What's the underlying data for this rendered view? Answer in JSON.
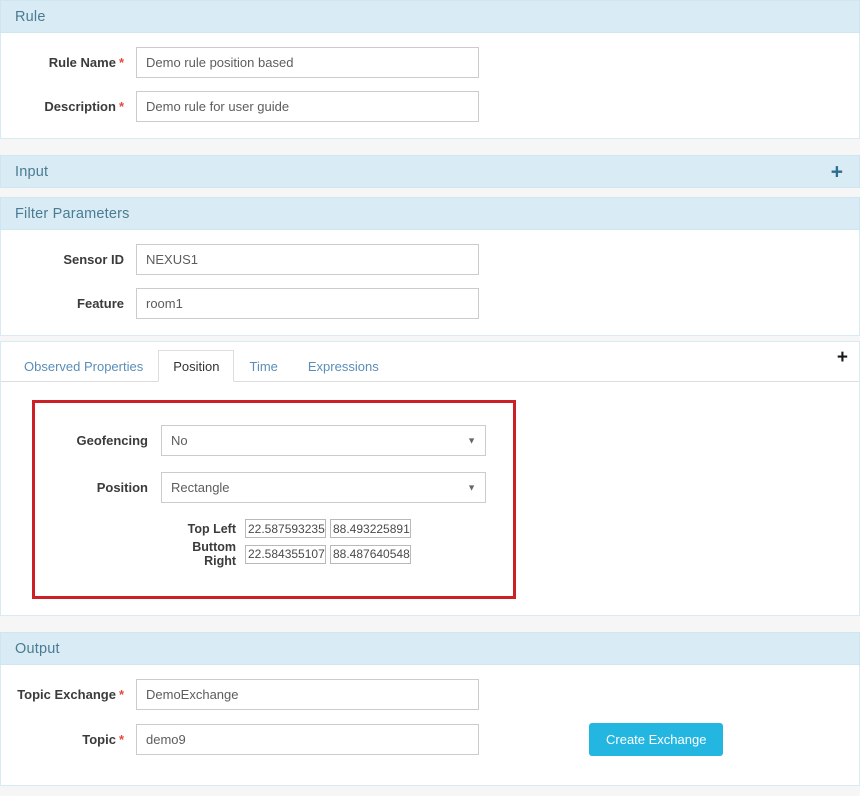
{
  "rule": {
    "header": "Rule",
    "fields": [
      {
        "label": "Rule Name",
        "required": "*",
        "value": "Demo rule position based"
      },
      {
        "label": "Description",
        "required": "*",
        "value": "Demo rule for user guide"
      }
    ]
  },
  "input": {
    "header": "Input",
    "add_icon": "+"
  },
  "filter": {
    "header": "Filter Parameters",
    "fields": [
      {
        "label": "Sensor ID",
        "value": "NEXUS1"
      },
      {
        "label": "Feature",
        "value": "room1"
      }
    ]
  },
  "tabs": {
    "items": [
      {
        "label": "Observed Properties",
        "active": false
      },
      {
        "label": "Position",
        "active": true
      },
      {
        "label": "Time",
        "active": false
      },
      {
        "label": "Expressions",
        "active": false
      }
    ],
    "add_icon": "+"
  },
  "position": {
    "geofencing": {
      "label": "Geofencing",
      "value": "No",
      "caret": "▼"
    },
    "shape": {
      "label": "Position",
      "value": "Rectangle",
      "caret": "▼"
    },
    "coordinates": [
      {
        "label": "Top Left",
        "lat": "22.587593235",
        "lon": "88.493225891"
      },
      {
        "label": "Buttom Right",
        "lat": "22.584355107",
        "lon": "88.487640548"
      }
    ],
    "highlight_color": "#cc2026"
  },
  "output": {
    "header": "Output",
    "fields": [
      {
        "label": "Topic Exchange",
        "required": "*",
        "value": "DemoExchange"
      },
      {
        "label": "Topic",
        "required": "*",
        "value": "demo9"
      }
    ],
    "create_button": "Create Exchange",
    "button_color": "#22b6e0"
  },
  "theme": {
    "header_bg": "#d9ecf5",
    "header_text": "#4a7b92",
    "required_color": "#e8473f"
  }
}
